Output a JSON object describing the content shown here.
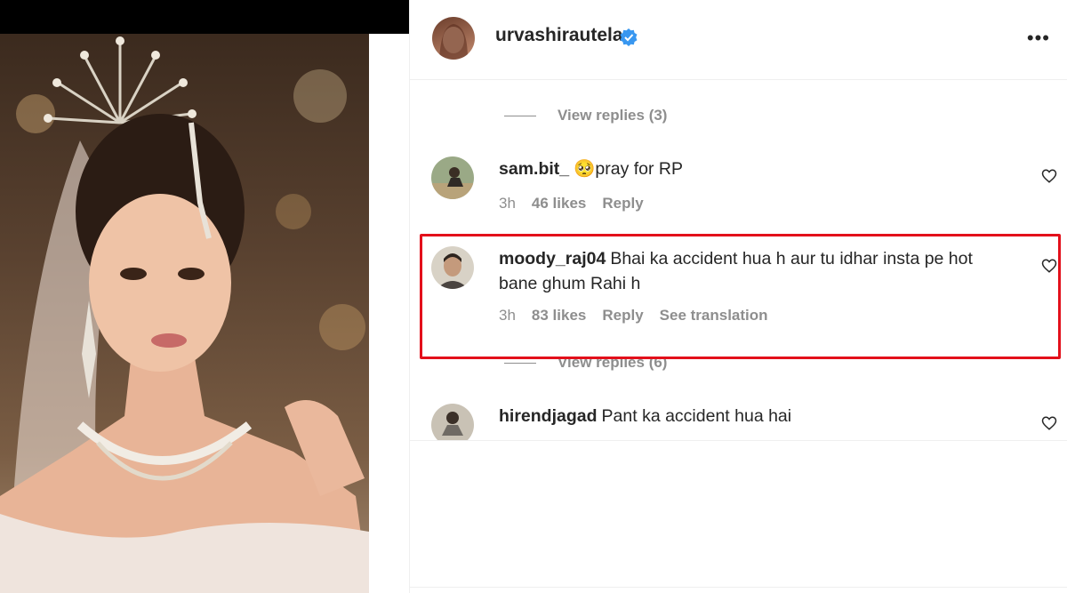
{
  "post": {
    "username": "urvashirautela",
    "verified": true,
    "more_icon": "more-horizontal-icon"
  },
  "comments": [
    {
      "username": "sam.bit_",
      "emoji": "🥺",
      "text": "pray for RP",
      "time": "3h",
      "likes": "46 likes",
      "reply": "Reply"
    },
    {
      "username": "moody_raj04",
      "text": "Bhai ka accident hua h aur tu idhar insta pe hot bane ghum Rahi h",
      "time": "3h",
      "likes": "83 likes",
      "reply": "Reply",
      "translation": "See translation",
      "highlighted": true
    },
    {
      "username": "hirendjagad",
      "text": "Pant ka accident hua hai"
    }
  ],
  "view_replies": [
    {
      "label": "View replies (3)"
    },
    {
      "label": "View replies (6)"
    }
  ],
  "colors": {
    "highlight": "#e3101b",
    "verified": "#3897f0",
    "muted": "#8e8e8e"
  }
}
